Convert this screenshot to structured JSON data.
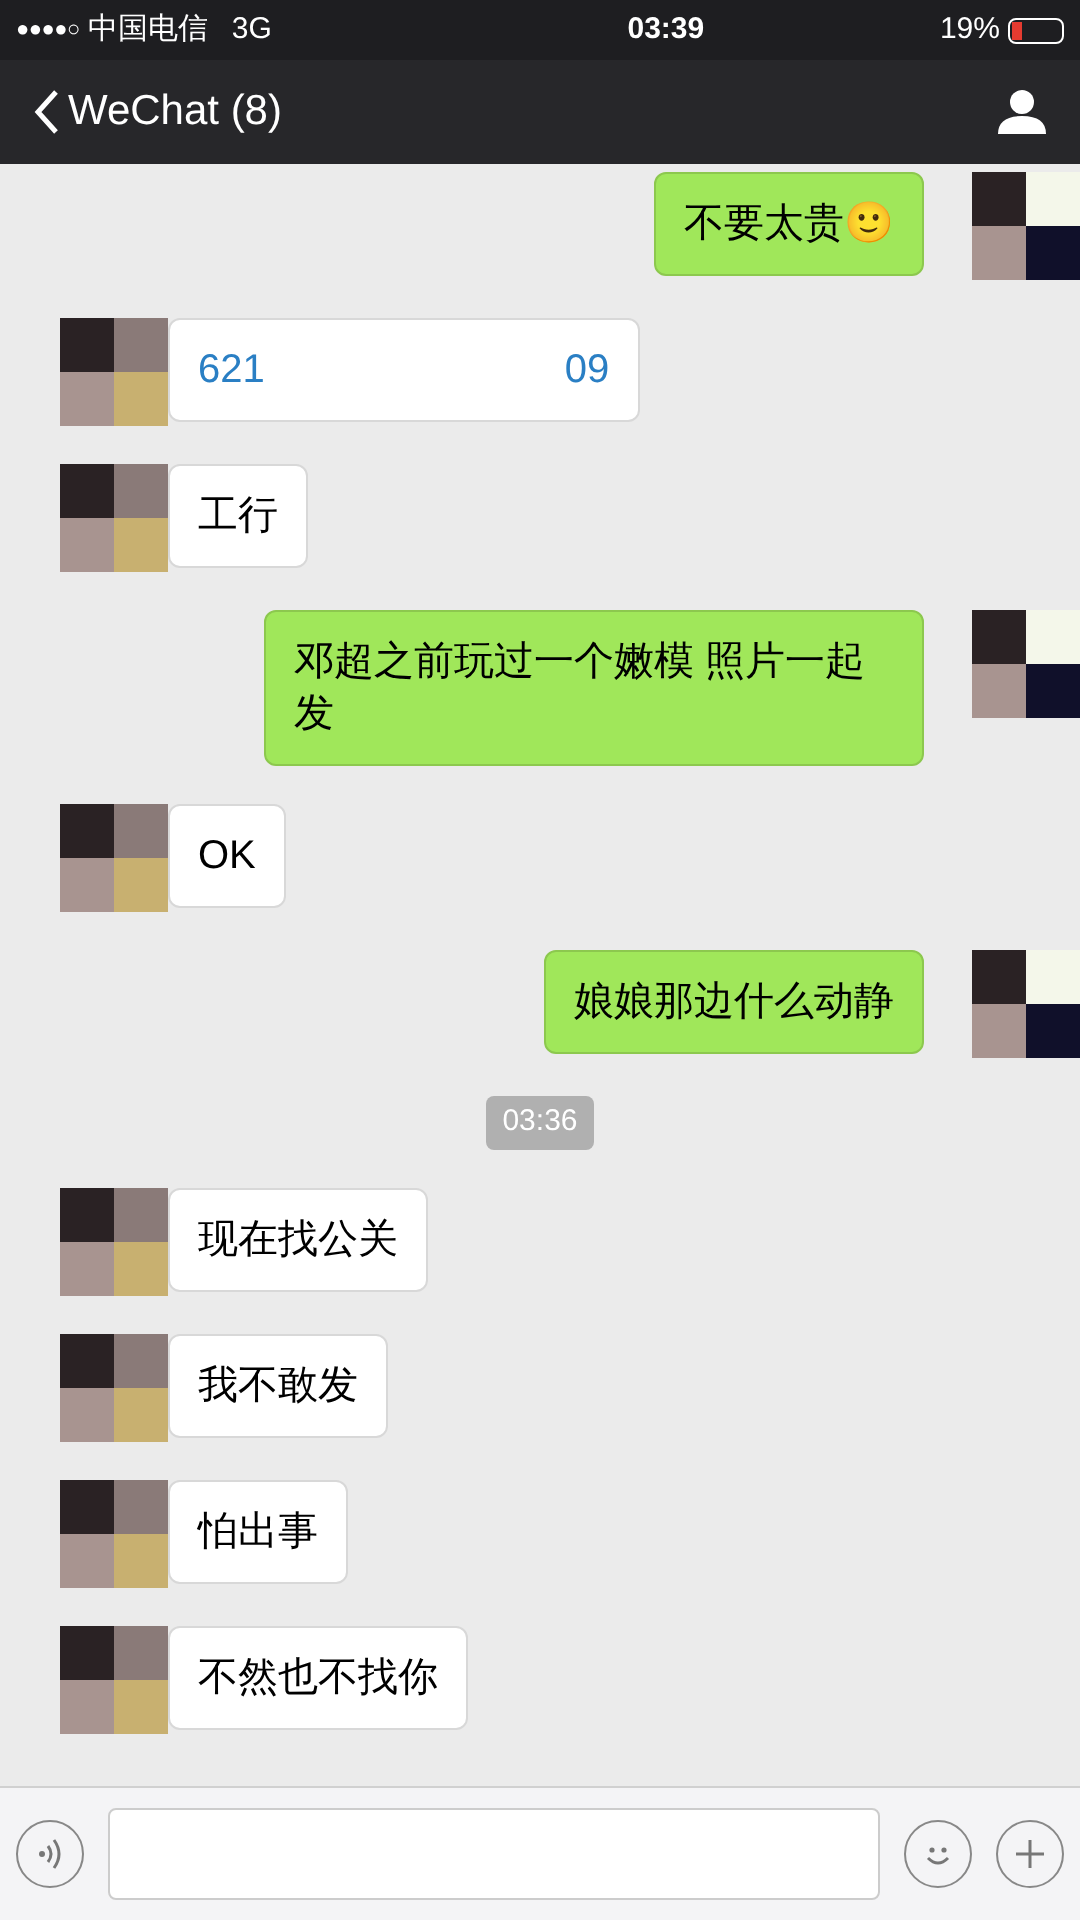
{
  "status_bar": {
    "signal": "●●●●○",
    "carrier": "中国电信",
    "network": "3G",
    "time": "03:39",
    "battery": "19%"
  },
  "nav": {
    "back_label": "WeChat (8)"
  },
  "messages": [
    {
      "kind": "sent",
      "parts": [
        "不要太贵🙂"
      ]
    },
    {
      "kind": "received",
      "link": true,
      "parts": [
        "621",
        "09"
      ]
    },
    {
      "kind": "received",
      "parts": [
        "工行"
      ]
    },
    {
      "kind": "sent",
      "parts": [
        "邓超之前玩过一个嫩模 照片一起发"
      ]
    },
    {
      "kind": "received",
      "parts": [
        "OK"
      ]
    },
    {
      "kind": "sent",
      "parts": [
        "娘娘那边什么动静"
      ]
    },
    {
      "kind": "time",
      "parts": [
        "03:36"
      ]
    },
    {
      "kind": "received",
      "parts": [
        "现在找公关"
      ]
    },
    {
      "kind": "received",
      "parts": [
        "我不敢发"
      ]
    },
    {
      "kind": "received",
      "parts": [
        "怕出事"
      ]
    },
    {
      "kind": "received",
      "parts": [
        "不然也不找你"
      ]
    }
  ]
}
